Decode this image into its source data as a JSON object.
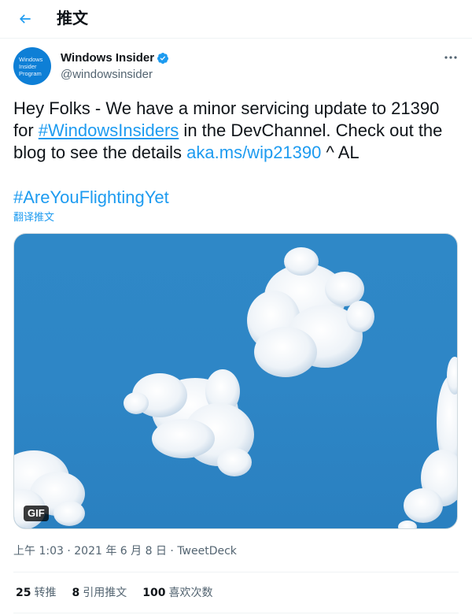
{
  "header": {
    "title": "推文",
    "back_icon": "arrow-left-icon"
  },
  "author": {
    "avatar_text": "Windows\nInsider\nProgram",
    "name": "Windows Insider",
    "handle": "@windowsinsider",
    "verified_icon": "verified-badge-icon"
  },
  "more_icon": "more-horizontal-icon",
  "tweet": {
    "text_part1": "Hey Folks - We have a minor servicing update to 21390 for ",
    "hashtag1": "#WindowsInsiders",
    "text_part2": " in the DevChannel. Check out the blog to see the details ",
    "link": "aka.ms/wip21390",
    "text_part3": " ^ AL",
    "hashtag2": "#AreYouFlightingYet",
    "translate_label": "翻译推文"
  },
  "media": {
    "badge": "GIF"
  },
  "meta": {
    "time": "上午 1:03",
    "separator1": " · ",
    "date": "2021 年 6 月 8 日",
    "separator2": " · ",
    "source": "TweetDeck"
  },
  "stats": {
    "retweets_count": "25",
    "retweets_label": "转推",
    "quotes_count": "8",
    "quotes_label": "引用推文",
    "likes_count": "100",
    "likes_label": "喜欢次数"
  },
  "colors": {
    "accent": "#1d9bf0",
    "sky": "#2f88c7",
    "text": "#0f1419",
    "muted": "#536471"
  }
}
